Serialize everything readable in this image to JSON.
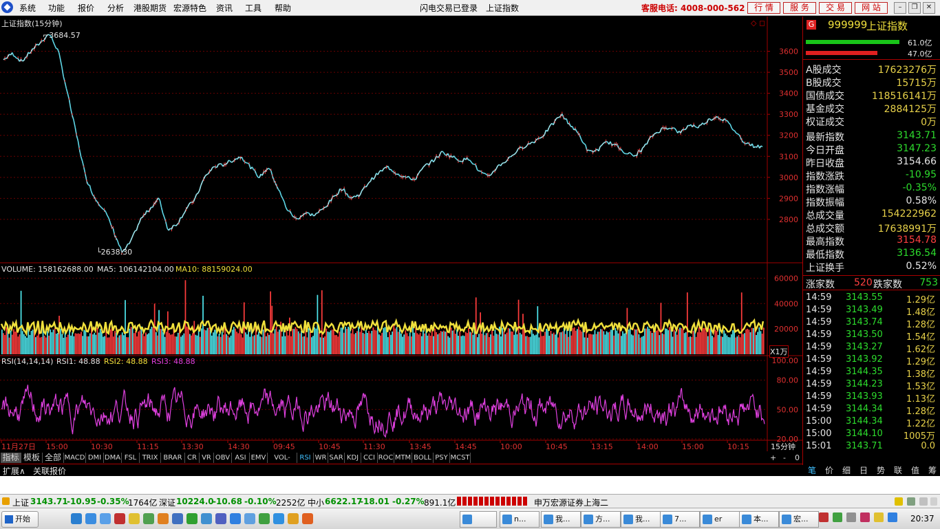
{
  "menu": {
    "items": [
      "系统",
      "功能",
      "报价",
      "分析",
      "港股期货",
      "宏源特色",
      "资讯",
      "工具",
      "帮助"
    ],
    "status": "闪电交易已登录",
    "title": "上证指数",
    "hotline": "客服电话: 4008-000-562",
    "buttons": [
      "行 情",
      "服 务",
      "交 易",
      "网 站"
    ]
  },
  "chart": {
    "title": "上证指数(15分钟)",
    "high_label": "3684.57",
    "low_label": "2638.30",
    "price_axis": [
      "3600",
      "3500",
      "3400",
      "3300",
      "3200",
      "3100",
      "3000",
      "2900",
      "2800"
    ],
    "volume_label": "VOLUME: 158162688.00",
    "ma5_label": "MA5: 106142104.00",
    "ma10_label": "MA10: 88159024.00",
    "volume_axis": [
      "60000",
      "40000",
      "20000"
    ],
    "volume_unit": "X1万",
    "rsi_label": "RSI(14,14,14)",
    "rsi1_label": "RSI1: 48.88",
    "rsi2_label": "RSI2: 48.88",
    "rsi3_label": "RSI3: 48.88",
    "rsi_axis": [
      "100.00",
      "80.00",
      "50.00",
      "20.00"
    ],
    "time_axis": [
      "11月27日",
      "15:00",
      "10:30",
      "11:15",
      "13:30",
      "14:30",
      "09:45",
      "10:45",
      "11:30",
      "13:45",
      "14:45",
      "10:00",
      "10:45",
      "13:15",
      "14:00",
      "15:00",
      "10:15"
    ],
    "period": "15分钟"
  },
  "chart_data": {
    "type": "line",
    "title": "上证指数(15分钟)",
    "series": [
      {
        "name": "上证指数",
        "values": [
          3560,
          3590,
          3550,
          3600,
          3640,
          3684.57,
          3600,
          3400,
          3200,
          3000,
          2900,
          2850,
          2750,
          2638.3,
          2700,
          2800,
          2850,
          2900,
          2750,
          2780,
          2850,
          2900,
          3000,
          3050,
          3060,
          3080,
          3100,
          3050,
          3000,
          3050,
          2950,
          2850,
          2800,
          2830,
          2820,
          2850,
          2900,
          2950,
          2900,
          2920,
          2980,
          3020,
          3050,
          3020,
          3000,
          2990,
          3050,
          3080,
          3120,
          3100,
          3080,
          3090,
          3030,
          3000,
          3050,
          3080,
          3120,
          3150,
          3170,
          3200,
          3250,
          3300,
          3250,
          3200,
          3120,
          3130,
          3170,
          3150,
          3120,
          3100,
          3140,
          3200,
          3230,
          3240,
          3210,
          3250,
          3240,
          3270,
          3290,
          3270,
          3220,
          3170,
          3150,
          3143.71
        ]
      }
    ],
    "ylim": [
      2600,
      3700
    ],
    "volume_ylim": [
      0,
      70000
    ],
    "rsi_ylim": [
      20,
      100
    ]
  },
  "panel": {
    "code": "999999",
    "name": "上证指数",
    "bar1": "61.0亿",
    "bar2": "47.0亿",
    "rows": [
      {
        "k": "A股成交",
        "v": "17623276万",
        "c": "#e8d24a"
      },
      {
        "k": "B股成交",
        "v": "15715万",
        "c": "#e8d24a"
      },
      {
        "k": "国债成交",
        "v": "118516141万",
        "c": "#e8d24a"
      },
      {
        "k": "基金成交",
        "v": "2884125万",
        "c": "#e8d24a"
      },
      {
        "k": "权证成交",
        "v": "0万",
        "c": "#e8d24a"
      },
      {
        "k": "最新指数",
        "v": "3143.71",
        "c": "#2ddc2d"
      },
      {
        "k": "今日开盘",
        "v": "3147.23",
        "c": "#2ddc2d"
      },
      {
        "k": "昨日收盘",
        "v": "3154.66",
        "c": "#e6e6e6"
      },
      {
        "k": "指数涨跌",
        "v": "-10.95",
        "c": "#2ddc2d"
      },
      {
        "k": "指数涨幅",
        "v": "-0.35%",
        "c": "#2ddc2d"
      },
      {
        "k": "指数振幅",
        "v": "0.58%",
        "c": "#e6e6e6"
      },
      {
        "k": "总成交量",
        "v": "154222962",
        "c": "#e8d24a"
      },
      {
        "k": "总成交额",
        "v": "17638991万",
        "c": "#e8d24a"
      },
      {
        "k": "最高指数",
        "v": "3154.78",
        "c": "#ff4040"
      },
      {
        "k": "最低指数",
        "v": "3136.54",
        "c": "#2ddc2d"
      },
      {
        "k": "上证换手",
        "v": "0.52%",
        "c": "#e6e6e6"
      }
    ],
    "up_label": "涨家数",
    "up_count": "520",
    "down_label": "跌家数",
    "down_count": "753",
    "ticks": [
      {
        "t": "14:59",
        "p": "3143.55",
        "q": "1.29亿"
      },
      {
        "t": "14:59",
        "p": "3143.49",
        "q": "1.48亿"
      },
      {
        "t": "14:59",
        "p": "3143.74",
        "q": "1.28亿"
      },
      {
        "t": "14:59",
        "p": "3143.50",
        "q": "1.54亿"
      },
      {
        "t": "14:59",
        "p": "3143.27",
        "q": "1.62亿"
      },
      {
        "t": "14:59",
        "p": "3143.92",
        "q": "1.29亿"
      },
      {
        "t": "14:59",
        "p": "3144.35",
        "q": "1.38亿"
      },
      {
        "t": "14:59",
        "p": "3144.23",
        "q": "1.53亿"
      },
      {
        "t": "14:59",
        "p": "3143.93",
        "q": "1.13亿"
      },
      {
        "t": "14:59",
        "p": "3144.34",
        "q": "1.28亿"
      },
      {
        "t": "15:00",
        "p": "3144.34",
        "q": "1.22亿"
      },
      {
        "t": "15:00",
        "p": "3144.10",
        "q": "1005万"
      },
      {
        "t": "15:01",
        "p": "3143.71",
        "q": "0.0"
      }
    ],
    "tabs": [
      "笔",
      "价",
      "细",
      "日",
      "势",
      "联",
      "值",
      "筹"
    ]
  },
  "indicator_tabs": [
    "指标",
    "模板",
    "全部",
    "MACD",
    "DMI",
    "DMA",
    "FSL",
    "TRIX",
    "BRAR",
    "CR",
    "VR",
    "OBV",
    "ASI",
    "EMV",
    "VOL-TDX",
    "RSI",
    "WR",
    "SAR",
    "KDJ",
    "CCI",
    "ROC",
    "MTM",
    "BOLL",
    "PSY",
    "MCST"
  ],
  "subtabs": [
    "扩展∧",
    "关联报价"
  ],
  "zoom_controls": [
    "+",
    "-",
    "0"
  ],
  "statusbar": {
    "sh_name": "上证",
    "sh_val": "3143.71",
    "sh_chg": "-10.95",
    "sh_pct": "-0.35%",
    "sh_amt": "1764亿",
    "sz_name": "深证",
    "sz_val": "10224.0",
    "sz_chg": "-10.68",
    "sz_pct": "-0.10%",
    "sz_amt": "2252亿",
    "zx_name": "中小",
    "zx_val": "6622.17",
    "zx_chg": "-18.01",
    "zx_pct": "-0.27%",
    "zx_amt": "891.1亿",
    "broker": "申万宏源证券上海二"
  },
  "taskbar": {
    "start": "开始",
    "items": [
      "",
      "n...",
      "我...",
      "方...",
      "我...",
      "7...",
      "er",
      "本...",
      "宏..."
    ],
    "clock": "20:37"
  }
}
